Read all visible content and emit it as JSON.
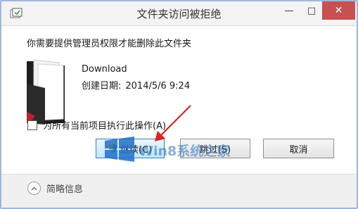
{
  "window": {
    "title": "文件夹访问被拒绝"
  },
  "message": "你需要提供管理员权限才能删除此文件夹",
  "item": {
    "name": "Download",
    "created_label": "创建日期:",
    "created_value": "2014/5/6 9:24"
  },
  "checkbox": {
    "label": "为所有当前项目执行此操作(A)",
    "checked": false
  },
  "buttons": {
    "continue": "继续(C)",
    "skip": "跳过(S)",
    "cancel": "取消"
  },
  "footer": {
    "details": "简略信息"
  },
  "watermark": {
    "text": "Win8系统之家"
  },
  "colors": {
    "close_button": "#c75050",
    "annotation_arrow": "#e02020",
    "default_button_border": "#3c7fb1"
  }
}
